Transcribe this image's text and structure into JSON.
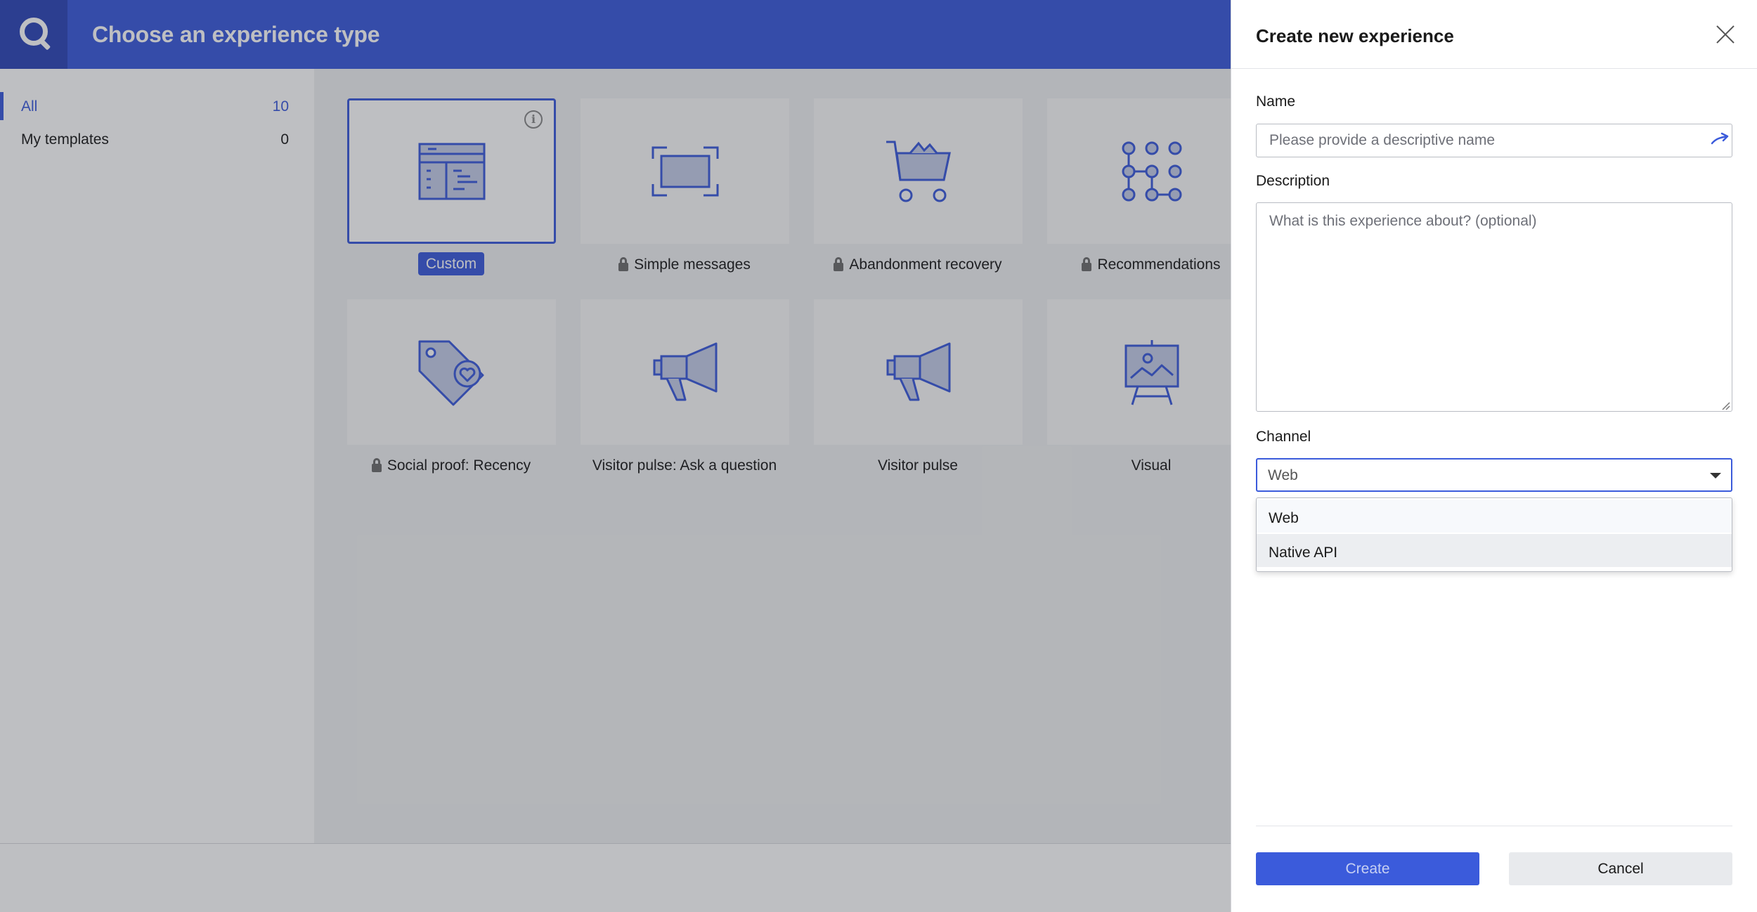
{
  "app": {
    "title": "Choose an experience type"
  },
  "sidebar": {
    "items": [
      {
        "label": "All",
        "count": "10",
        "active": true
      },
      {
        "label": "My templates",
        "count": "0",
        "active": false
      }
    ]
  },
  "tiles": [
    {
      "label": "Custom",
      "icon": "layout-icon",
      "locked": false,
      "selected": true
    },
    {
      "label": "Simple messages",
      "icon": "message-frame-icon",
      "locked": true,
      "selected": false
    },
    {
      "label": "Abandonment recovery",
      "icon": "shopping-cart-icon",
      "locked": true,
      "selected": false
    },
    {
      "label": "Recommendations",
      "icon": "network-grid-icon",
      "locked": true,
      "selected": false
    },
    {
      "label": "Social proof: Recency",
      "icon": "heart-tag-icon",
      "locked": true,
      "selected": false
    },
    {
      "label": "Visitor pulse: Ask a question",
      "icon": "megaphone-icon",
      "locked": false,
      "selected": false
    },
    {
      "label": "Visitor pulse",
      "icon": "megaphone-icon",
      "locked": false,
      "selected": false
    },
    {
      "label": "Visual",
      "icon": "easel-image-icon",
      "locked": false,
      "selected": false
    }
  ],
  "panel": {
    "title": "Create new experience",
    "name_label": "Name",
    "name_placeholder": "Please provide a descriptive name",
    "name_value": "",
    "description_label": "Description",
    "description_placeholder": "What is this experience about? (optional)",
    "description_value": "",
    "channel_label": "Channel",
    "channel_value": "Web",
    "channel_options": [
      "Web",
      "Native API"
    ],
    "create_label": "Create",
    "cancel_label": "Cancel"
  },
  "colors": {
    "accent": "#3b5bdb",
    "icon_stroke": "#3b5bdb",
    "icon_fill": "#c5cde8"
  }
}
